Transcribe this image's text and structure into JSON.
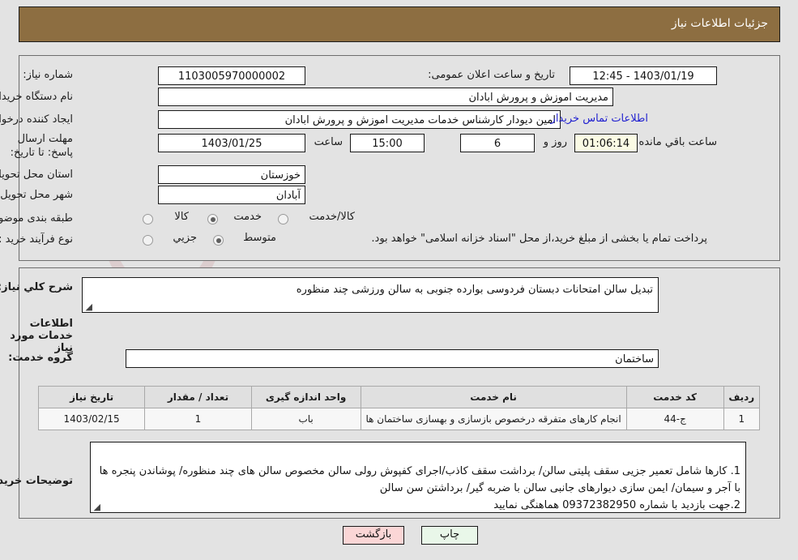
{
  "header": {
    "title": "جزئیات اطلاعات نیاز"
  },
  "watermark": {
    "text": "AriaTender.net"
  },
  "form": {
    "need_number_label": "شماره نیاز:",
    "need_number_value": "1103005970000002",
    "public_announce_label": "تاریخ و ساعت اعلان عمومی:",
    "public_announce_value": "1403/01/19 - 12:45",
    "buyer_org_label": "نام دستگاه خریدار:",
    "buyer_org_value": "مدیریت اموزش و پرورش ابادان",
    "requester_label": "ایجاد کننده درخواست:",
    "requester_value": "امین دیودار کارشناس خدمات مدیریت اموزش و پرورش ابادان",
    "contact_link": "اطلاعات تماس خریدار",
    "deadline_label": "مهلت ارسال پاسخ: تا تاریخ:",
    "deadline_date": "1403/01/25",
    "deadline_hour_label": "ساعت",
    "deadline_hour_value": "15:00",
    "days_value": "6",
    "days_unit_label": "روز و",
    "countdown_value": "01:06:14",
    "countdown_unit_label": "ساعت باقي مانده",
    "province_label": "استان محل تحویل:",
    "province_value": "خوزستان",
    "city_label": "شهر محل تحویل:",
    "city_value": "آبادان",
    "category_label": "طبقه بندی موضوعی:",
    "category_options": [
      "کالا",
      "خدمت",
      "کالا/خدمت"
    ],
    "category_selected": "خدمت",
    "process_label": "نوع فرآیند خرید :",
    "process_options": [
      "جزیي",
      "متوسط"
    ],
    "process_selected": "متوسط",
    "treasury_note": "پرداخت تمام یا بخشی از مبلغ خرید،از محل \"اسناد خزانه اسلامی\" خواهد بود."
  },
  "details": {
    "summary_label": "شرح کلي نیاز:",
    "summary_value": "تبدیل سالن امتحانات دبستان فردوسی بوارده جنوبی به سالن ورزشی چند منظوره",
    "services_section_title": "اطلاعات خدمات مورد نیاز",
    "service_group_label": "گروه خدمت:",
    "service_group_value": "ساختمان"
  },
  "table": {
    "columns": [
      "ردیف",
      "کد خدمت",
      "نام خدمت",
      "واحد اندازه گیری",
      "تعداد / مقدار",
      "تاریخ نیاز"
    ],
    "rows": [
      {
        "row": "1",
        "code": "ج-44",
        "name": "انجام کارهای متفرقه درخصوص بازسازی و بهسازی ساختمان ها",
        "unit": "باب",
        "qty": "1",
        "date": "1403/02/15"
      }
    ]
  },
  "notes": {
    "label": "توضیحات خریدار:",
    "value": "1. کارها شامل تعمیر جزیی سقف پلیتی سالن/ برداشت سقف کاذب/اجرای کفپوش رولی سالن مخصوص سالن های چند منظوره/ پوشاندن پنجره ها با آجر و سیمان/ ایمن سازی دیوارهای جانبی سالن با ضربه گیر/ برداشتن سن سالن\n2.جهت بازدید با شماره 09372382950 هماهنگی نمایید"
  },
  "buttons": {
    "print": "چاپ",
    "back": "بازگشت"
  },
  "colors": {
    "header_brown": "#8d6e41",
    "page_gray": "#e3e3e3",
    "link_blue": "#2222d0",
    "print_green": "#e9f7e9",
    "back_pink": "#fbd6d6",
    "countdown_yellow": "#fbfbe4"
  }
}
